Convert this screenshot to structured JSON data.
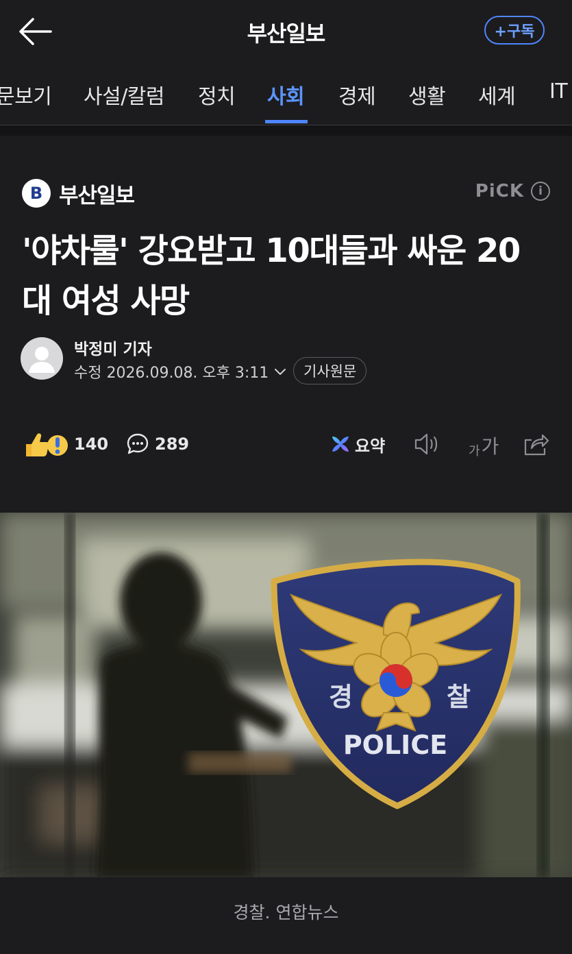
{
  "header": {
    "title": "부산일보",
    "subscribe_label": "+구독"
  },
  "tabs": [
    "문보기",
    "사설/칼럼",
    "정치",
    "사회",
    "경제",
    "생활",
    "세계",
    "IT"
  ],
  "active_tab": "사회",
  "article": {
    "publisher": "부산일보",
    "publisher_logo_letter": "B",
    "pick_label": "PiCK",
    "headline": "'야차룰' 강요받고 10대들과 싸운 20대 여성 사망",
    "reporter": "박정미 기자",
    "date": "수정 2026.09.08. 오후 3:11",
    "original_button": "기사원문"
  },
  "actions": {
    "reactions_count": "140",
    "comments_count": "289",
    "summary_label": "요약",
    "font_small": "가",
    "font_large": "가"
  },
  "photo": {
    "emblem_left_char": "경",
    "emblem_right_char": "찰",
    "emblem_text": "POLICE",
    "caption": "경찰. 연합뉴스"
  },
  "colors": {
    "background": "#1c1c1e",
    "accent": "#4f86ff",
    "muted": "#8e8e93"
  },
  "icons": [
    "back-arrow-icon",
    "info-icon",
    "chevron-down-icon",
    "reaction-emoji-icon",
    "comment-icon",
    "ai-summary-icon",
    "speaker-icon",
    "share-icon",
    "avatar-icon"
  ]
}
